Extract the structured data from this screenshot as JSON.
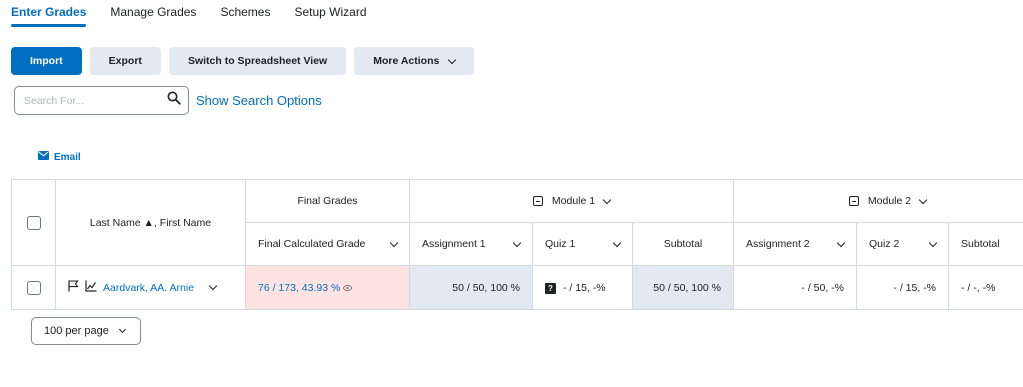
{
  "tabs": [
    {
      "label": "Enter Grades"
    },
    {
      "label": "Manage Grades"
    },
    {
      "label": "Schemes"
    },
    {
      "label": "Setup Wizard"
    }
  ],
  "toolbar": {
    "import": "Import",
    "export": "Export",
    "spreadsheet": "Switch to Spreadsheet View",
    "more_actions": "More Actions"
  },
  "search": {
    "placeholder": "Search For...",
    "show_options": "Show Search Options"
  },
  "email": "Email",
  "table": {
    "name_header": "Last Name ▲, First Name",
    "final_grades": "Final Grades",
    "final_calculated": "Final Calculated Grade",
    "module1": "Module 1",
    "module2": "Module 2",
    "assignment1": "Assignment 1",
    "quiz1": "Quiz 1",
    "subtotal1": "Subtotal",
    "assignment2": "Assignment 2",
    "quiz2": "Quiz 2",
    "subtotal2": "Subtotal",
    "rows": [
      {
        "student": "Aardvark, AA. Arnie",
        "final": "76 / 173, 43.93 %",
        "assignment1": "50 / 50, 100 %",
        "quiz1": "- / 15, -%",
        "subtotal1": "50 / 50, 100 %",
        "assignment2": "- / 50, -%",
        "quiz2": "- / 15, -%",
        "subtotal2": "- / -, -%"
      }
    ]
  },
  "per_page": "100 per page",
  "colors": {
    "accent": "#006fbf",
    "button_bg": "#e3e9f1",
    "final_bg": "#ffe2e2"
  }
}
